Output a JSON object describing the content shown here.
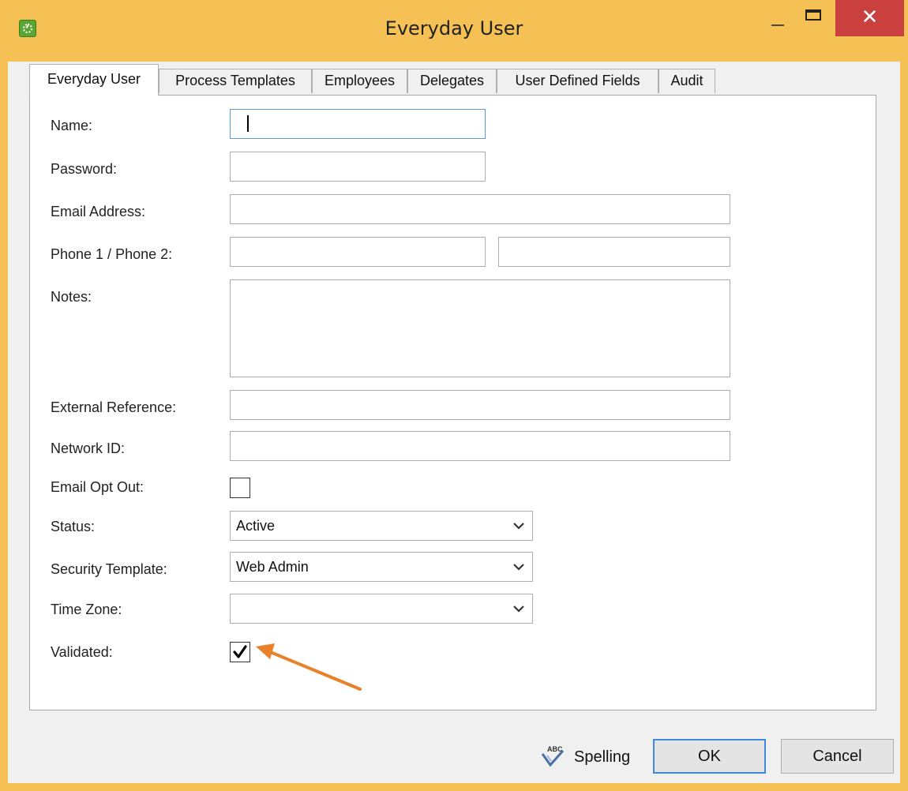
{
  "window": {
    "title": "Everyday User",
    "close_glyph": "✕"
  },
  "tabs": [
    {
      "label": "Everyday User",
      "active": true
    },
    {
      "label": "Process Templates",
      "active": false
    },
    {
      "label": "Employees",
      "active": false
    },
    {
      "label": "Delegates",
      "active": false
    },
    {
      "label": "User Defined Fields",
      "active": false
    },
    {
      "label": "Audit",
      "active": false
    }
  ],
  "form": {
    "name": {
      "label": "Name:",
      "value": ""
    },
    "password": {
      "label": "Password:",
      "value": ""
    },
    "email": {
      "label": "Email Address:",
      "value": ""
    },
    "phone": {
      "label": "Phone 1 / Phone 2:",
      "phone1": "",
      "phone2": ""
    },
    "notes": {
      "label": "Notes:",
      "value": ""
    },
    "external_reference": {
      "label": "External Reference:",
      "value": ""
    },
    "network_id": {
      "label": "Network ID:",
      "value": ""
    },
    "email_opt_out": {
      "label": "Email Opt Out:",
      "checked": false
    },
    "status": {
      "label": "Status:",
      "value": "Active"
    },
    "security_template": {
      "label": "Security Template:",
      "value": "Web Admin"
    },
    "time_zone": {
      "label": "Time Zone:",
      "value": ""
    },
    "validated": {
      "label": "Validated:",
      "checked": true
    }
  },
  "buttons": {
    "spelling": "Spelling",
    "spelling_icon_text": "ABC",
    "ok": "OK",
    "cancel": "Cancel"
  },
  "icons": {
    "app": "app-logo-icon",
    "annotation": "orange-arrow-pointer"
  },
  "colors": {
    "title_bar": "#f5c054",
    "close_button": "#c9403f",
    "focus_border": "#5b9bd5",
    "annotation_arrow": "#e8812a",
    "default_button_border": "#3c8ad8"
  }
}
